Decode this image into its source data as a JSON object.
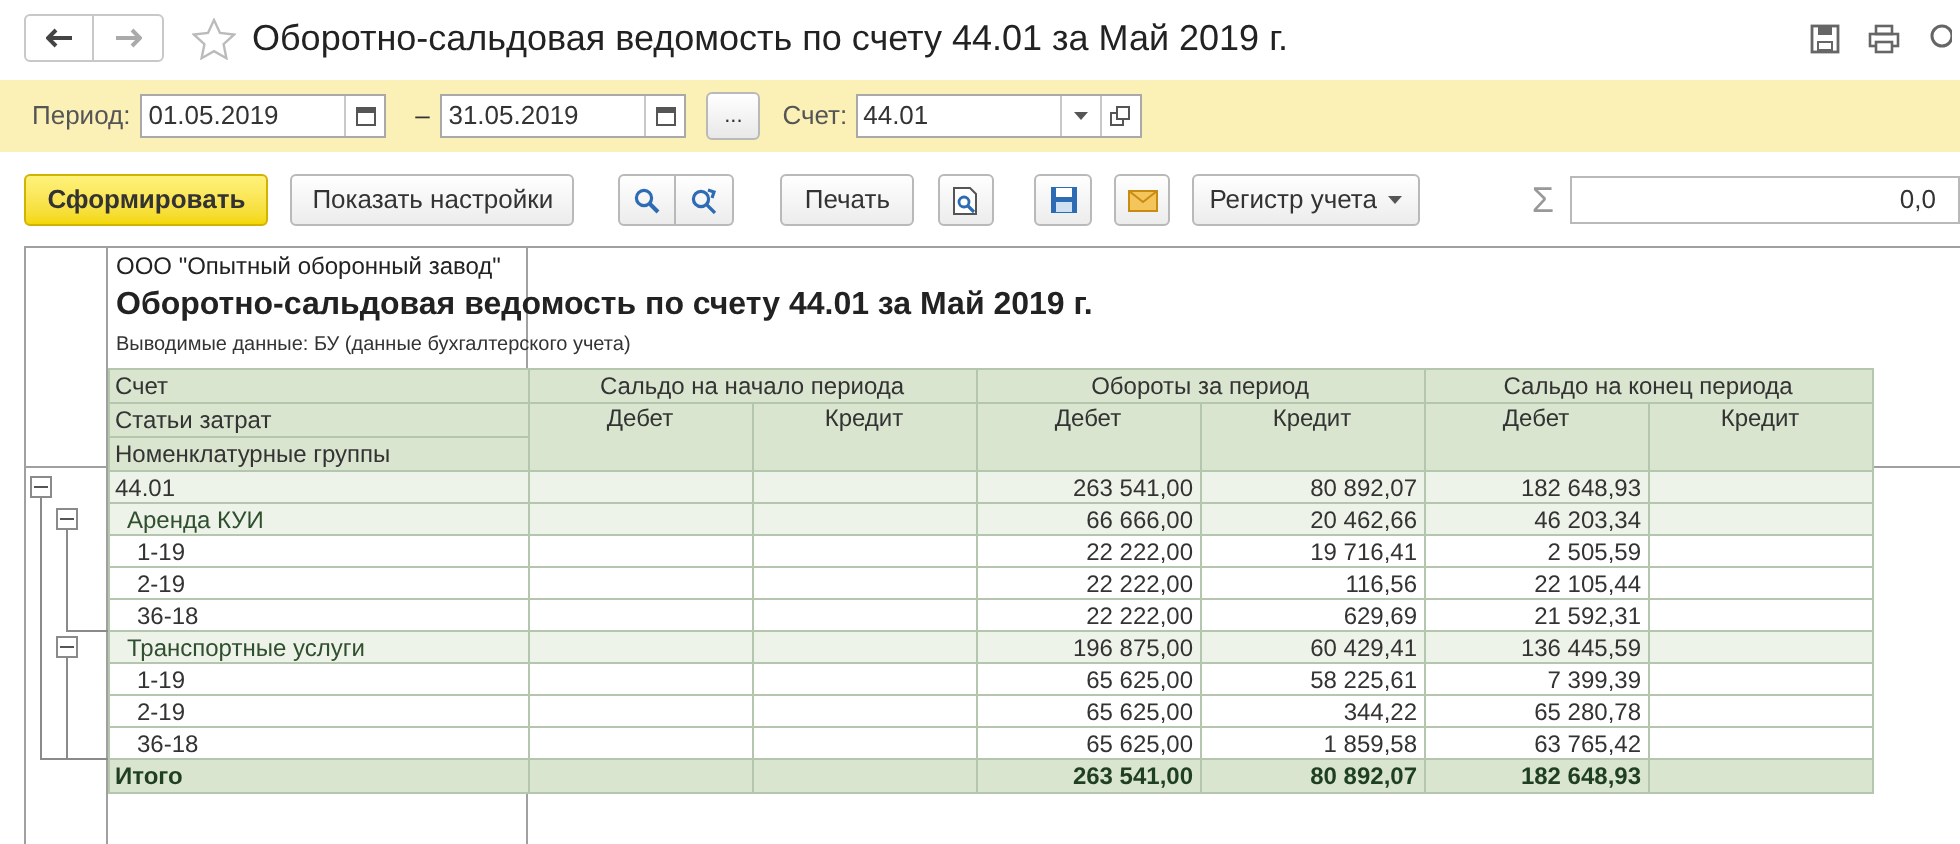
{
  "window": {
    "title": "Оборотно-сальдовая ведомость по счету 44.01 за Май 2019 г."
  },
  "filter": {
    "period_label": "Период:",
    "from": "01.05.2019",
    "separator": "–",
    "to": "31.05.2019",
    "more_button": "...",
    "account_label": "Счет:",
    "account": "44.01"
  },
  "toolbar": {
    "generate": "Сформировать",
    "settings": "Показать настройки",
    "print": "Печать",
    "register": "Регистр учета",
    "sum_symbol": "Σ",
    "sum_value": "0,0"
  },
  "report": {
    "organization": "ООО \"Опытный оборонный завод\"",
    "title": "Оборотно-сальдовая ведомость по счету 44.01 за Май 2019 г.",
    "subtitle": "Выводимые данные: БУ (данные бухгалтерского учета)",
    "row_headers": [
      "Счет",
      "Статьи затрат",
      "Номенклатурные группы"
    ],
    "column_groups": [
      {
        "label": "Сальдо на начало периода",
        "columns": [
          "Дебет",
          "Кредит"
        ]
      },
      {
        "label": "Обороты за период",
        "columns": [
          "Дебет",
          "Кредит"
        ]
      },
      {
        "label": "Сальдо на конец периода",
        "columns": [
          "Дебет",
          "Кредит"
        ]
      }
    ],
    "rows": [
      {
        "label": "44.01",
        "expanded": true,
        "turnover_debit": "263 541,00",
        "turnover_credit": "80 892,07",
        "closing_debit": "182 648,93",
        "children": [
          {
            "label": "Аренда КУИ",
            "expanded": true,
            "turnover_debit": "66 666,00",
            "turnover_credit": "20 462,66",
            "closing_debit": "46 203,34",
            "children": [
              {
                "label": "1-19",
                "turnover_debit": "22 222,00",
                "turnover_credit": "19 716,41",
                "closing_debit": "2 505,59"
              },
              {
                "label": "2-19",
                "turnover_debit": "22 222,00",
                "turnover_credit": "116,56",
                "closing_debit": "22 105,44"
              },
              {
                "label": "36-18",
                "turnover_debit": "22 222,00",
                "turnover_credit": "629,69",
                "closing_debit": "21 592,31"
              }
            ]
          },
          {
            "label": "Транспортные услуги",
            "expanded": true,
            "turnover_debit": "196 875,00",
            "turnover_credit": "60 429,41",
            "closing_debit": "136 445,59",
            "children": [
              {
                "label": "1-19",
                "turnover_debit": "65 625,00",
                "turnover_credit": "58 225,61",
                "closing_debit": "7 399,39"
              },
              {
                "label": "2-19",
                "turnover_debit": "65 625,00",
                "turnover_credit": "344,22",
                "closing_debit": "65 280,78"
              },
              {
                "label": "36-18",
                "turnover_debit": "65 625,00",
                "turnover_credit": "1 859,58",
                "closing_debit": "63 765,42"
              }
            ]
          }
        ]
      }
    ],
    "total": {
      "label": "Итого",
      "turnover_debit": "263 541,00",
      "turnover_credit": "80 892,07",
      "closing_debit": "182 648,93"
    }
  }
}
